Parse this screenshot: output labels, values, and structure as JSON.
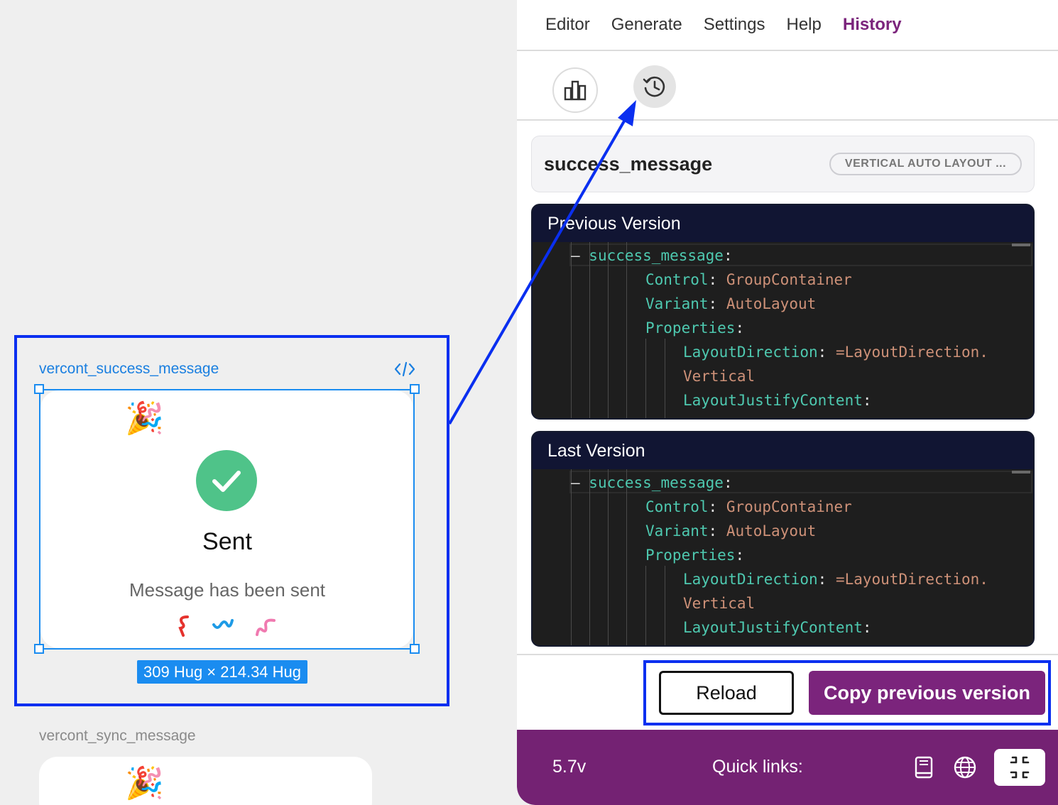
{
  "canvas": {
    "frame1_title": "vercont_success_message",
    "card": {
      "title": "Sent",
      "subtitle": "Message has been sent"
    },
    "size_badge": "309 Hug × 214.34 Hug",
    "frame2_title": "vercont_sync_message"
  },
  "panel": {
    "menu": [
      "Editor",
      "Generate",
      "Settings",
      "Help",
      "History"
    ],
    "active_menu": "History",
    "component": {
      "name": "success_message",
      "badge": "VERTICAL AUTO LAYOUT ..."
    },
    "previous": {
      "title": "Previous Version",
      "lines": {
        "l1k": "success_message",
        "l2k": "Control",
        "l2v": "GroupContainer",
        "l3k": "Variant",
        "l3v": "AutoLayout",
        "l4k": "Properties",
        "l5k": "LayoutDirection",
        "l5v": "=LayoutDirection.",
        "l6v": "Vertical",
        "l7k": "LayoutJustifyContent"
      }
    },
    "last": {
      "title": "Last Version",
      "lines": {
        "l1k": "success_message",
        "l2k": "Control",
        "l2v": "GroupContainer",
        "l3k": "Variant",
        "l3v": "AutoLayout",
        "l4k": "Properties",
        "l5k": "LayoutDirection",
        "l5v": "=LayoutDirection.",
        "l6v": "Vertical",
        "l7k": "LayoutJustifyContent"
      }
    },
    "buttons": {
      "reload": "Reload",
      "copy": "Copy previous version"
    },
    "status": {
      "version": "5.7v",
      "quick_links": "Quick links:"
    }
  },
  "colors": {
    "brand": "#7b247c",
    "highlight": "#0a2ff0",
    "selection": "#1a8cf0",
    "success": "#4fc389"
  }
}
